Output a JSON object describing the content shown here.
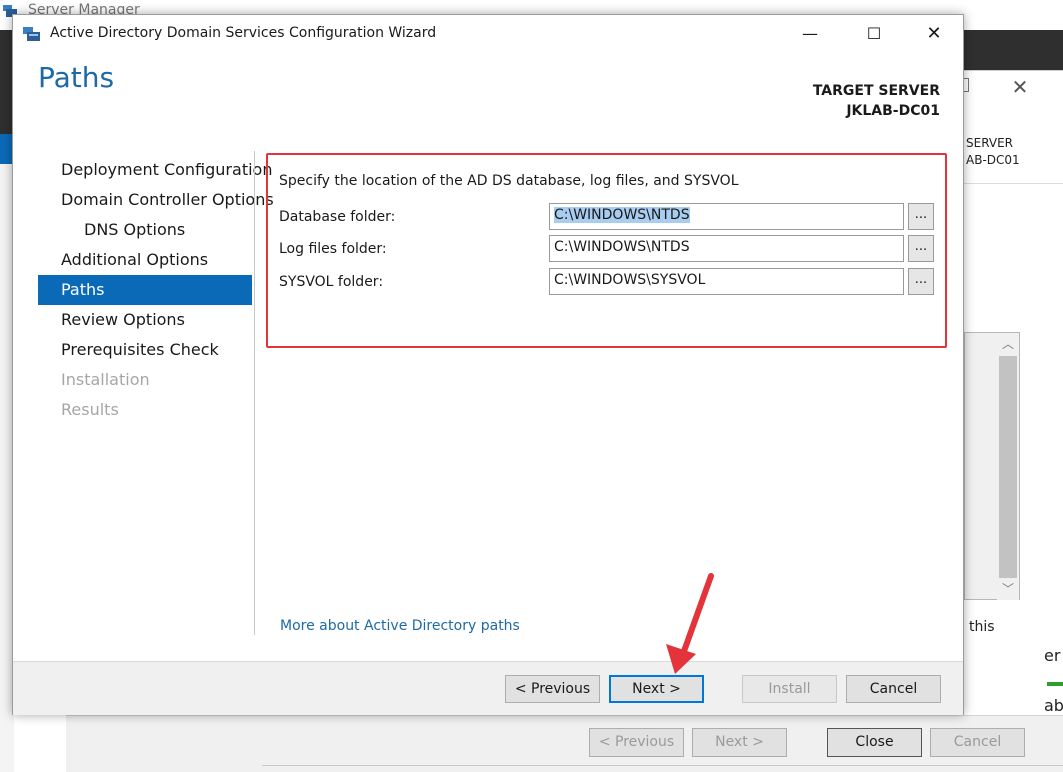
{
  "background": {
    "app_title": "Server Manager",
    "target_label": "SERVER",
    "target_name": "AB-DC01",
    "partial_text_this": "this",
    "partial_text_er": "er",
    "partial_text_ab": "ab",
    "buttons": {
      "previous": "< Previous",
      "next": "Next >",
      "close": "Close",
      "cancel": "Cancel"
    }
  },
  "wizard": {
    "title": "Active Directory Domain Services Configuration Wizard",
    "page_title": "Paths",
    "target_server_label": "TARGET SERVER",
    "target_server_name": "JKLAB-DC01",
    "nav": [
      {
        "label": "Deployment Configuration",
        "state": "normal"
      },
      {
        "label": "Domain Controller Options",
        "state": "normal"
      },
      {
        "label": "DNS Options",
        "state": "normal"
      },
      {
        "label": "Additional Options",
        "state": "normal"
      },
      {
        "label": "Paths",
        "state": "active"
      },
      {
        "label": "Review Options",
        "state": "normal"
      },
      {
        "label": "Prerequisites Check",
        "state": "normal"
      },
      {
        "label": "Installation",
        "state": "disabled"
      },
      {
        "label": "Results",
        "state": "disabled"
      }
    ],
    "instruction": "Specify the location of the AD DS database, log files, and SYSVOL",
    "fields": {
      "database": {
        "label": "Database folder:",
        "value": "C:\\WINDOWS\\NTDS",
        "browse": "..."
      },
      "log_files": {
        "label": "Log files folder:",
        "value": "C:\\WINDOWS\\NTDS",
        "browse": "..."
      },
      "sysvol": {
        "label": "SYSVOL folder:",
        "value": "C:\\WINDOWS\\SYSVOL",
        "browse": "..."
      }
    },
    "more_link": "More about Active Directory paths",
    "buttons": {
      "previous": "< Previous",
      "next": "Next >",
      "install": "Install",
      "cancel": "Cancel"
    }
  },
  "colors": {
    "accent": "#0b6ab8",
    "title_blue": "#1e6aa6",
    "highlight_box": "#e2343a",
    "selection": "#a8cdf0"
  }
}
